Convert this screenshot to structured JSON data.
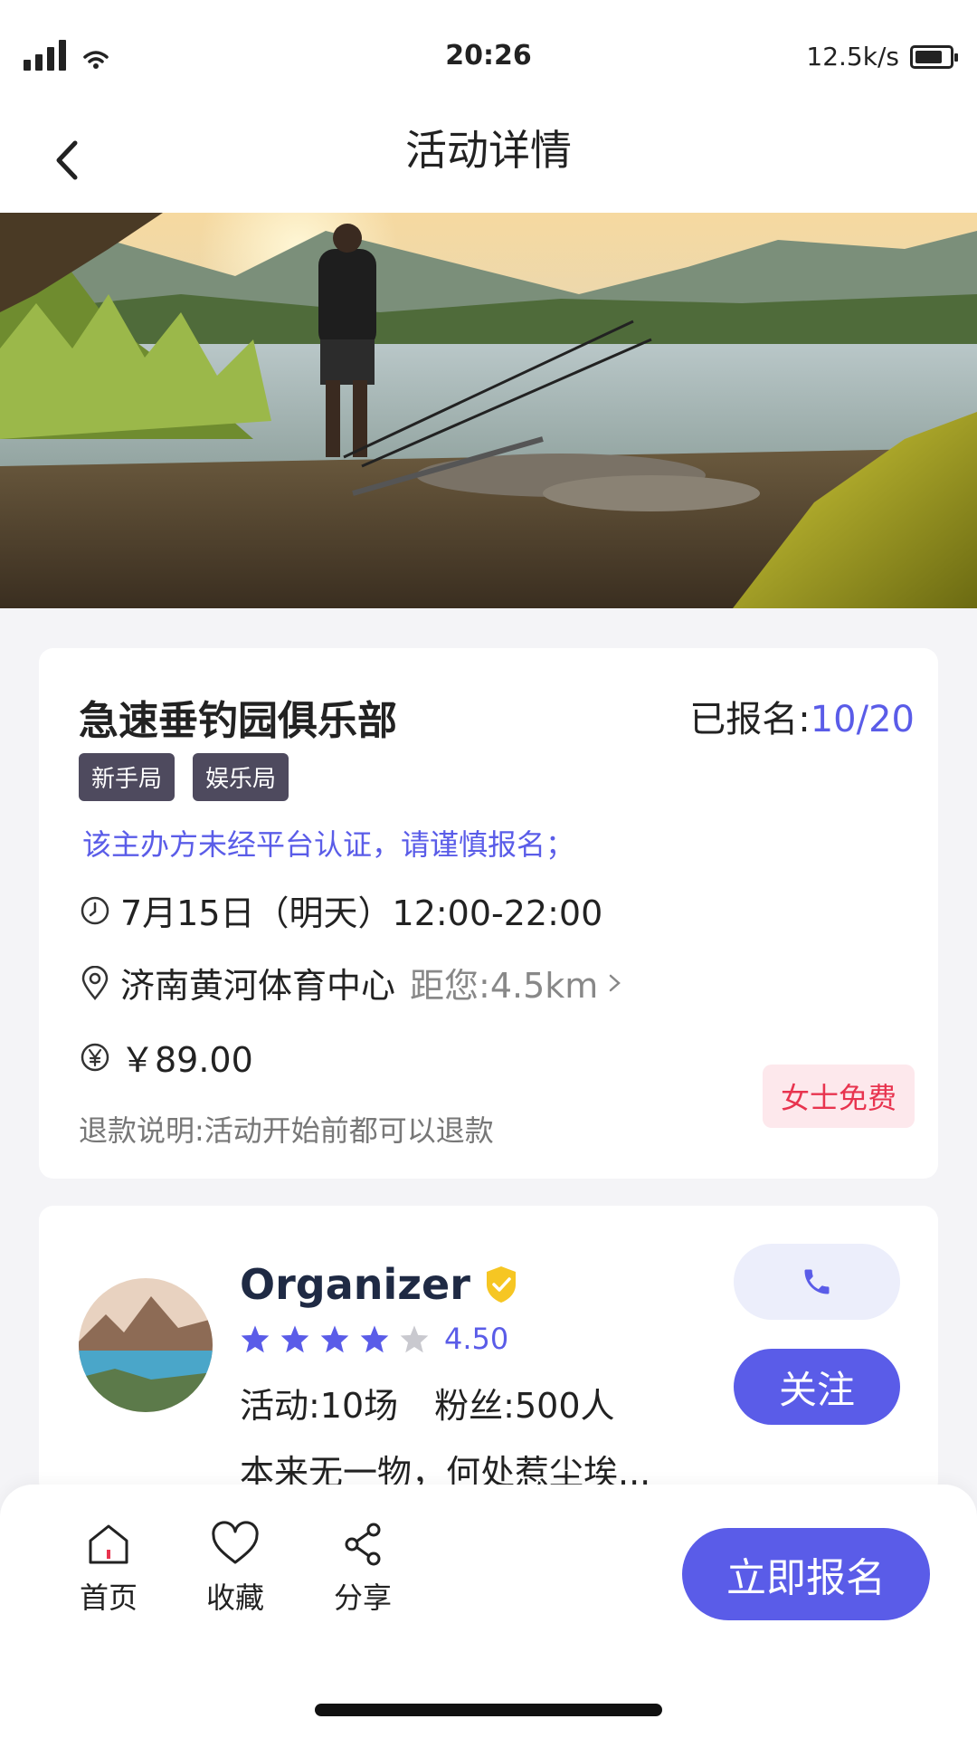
{
  "status_bar": {
    "time": "20:26",
    "network_speed": "12.5k/s",
    "icons": [
      "signal-icon",
      "wifi-icon",
      "battery-icon"
    ]
  },
  "nav": {
    "title": "活动详情",
    "back_icon": "chevron-left-icon"
  },
  "hero": {
    "description_icon": "hero-image"
  },
  "event": {
    "title": "急速垂钓园俱乐部",
    "signup_label": "已报名:",
    "signup_count": "10/20",
    "tags": [
      "新手局",
      "娱乐局"
    ],
    "notice": "该主办方未经平台认证，请谨慎报名；",
    "time": "7月15日（明天）12:00-22:00",
    "location": "济南黄河体育中心",
    "distance": "距您:4.5km",
    "price": "￥89.00",
    "refund": "退款说明:活动开始前都可以退款",
    "free_badge": "女士免费"
  },
  "organizer": {
    "name": "Organizer",
    "rating_value": "4.50",
    "rating_stars": 4.5,
    "activities": "活动:10场",
    "fans": "粉丝:500人",
    "bio": "本来无一物，何处惹尘埃...",
    "follow_label": "关注"
  },
  "bottom_bar": {
    "home_label": "首页",
    "favorite_label": "收藏",
    "share_label": "分享",
    "signup_button": "立即报名"
  },
  "colors": {
    "accent": "#5a5ce8",
    "tag_bg": "#4e4a5e",
    "badge_red": "#e8344f",
    "badge_bg": "#fde8ec"
  }
}
